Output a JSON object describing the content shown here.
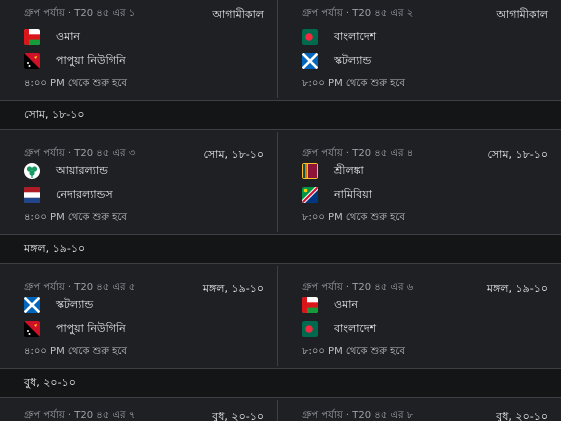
{
  "rows": [
    {
      "left": {
        "meta": "গ্রুপ পর্যায় · T20 ৪৫ এর ১",
        "time": "আগামীকাল",
        "team1": "ওমান",
        "team2": "পাপুয়া নিউগিনি",
        "start": "৪:০০ PM থেকে শুরু হবে"
      },
      "right": {
        "meta": "গ্রুপ পর্যায় · T20 ৪৫ এর ২",
        "time": "আগামীকাল",
        "team1": "বাংলাদেশ",
        "team2": "স্কটল্যান্ড",
        "start": "৮:০০ PM থেকে শুরু হবে"
      }
    },
    {
      "header": "সোম, ১৮-১০",
      "left": {
        "meta": "গ্রুপ পর্যায় · T20 ৪৫ এর ৩",
        "time": "সোম, ১৮-১০",
        "team1": "আয়ারল্যান্ড",
        "team2": "নেদারল্যান্ডস",
        "start": "৪:০০ PM থেকে শুরু হবে"
      },
      "right": {
        "meta": "গ্রুপ পর্যায় · T20 ৪৫ এর ৪",
        "time": "সোম, ১৮-১০",
        "team1": "শ্রীলঙ্কা",
        "team2": "নামিবিয়া",
        "start": "৮:০০ PM থেকে শুরু হবে"
      }
    },
    {
      "header": "মঙ্গল, ১৯-১০",
      "left": {
        "meta": "গ্রুপ পর্যায় · T20 ৪৫ এর ৫",
        "time": "মঙ্গল, ১৯-১০",
        "team1": "স্কটল্যান্ড",
        "team2": "পাপুয়া নিউগিনি",
        "start": "৪:০০ PM থেকে শুরু হবে"
      },
      "right": {
        "meta": "গ্রুপ পর্যায় · T20 ৪৫ এর ৬",
        "time": "মঙ্গল, ১৯-১০",
        "team1": "ওমান",
        "team2": "বাংলাদেশ",
        "start": "৮:০০ PM থেকে শুরু হবে"
      }
    },
    {
      "header": "বুধ, ২০-১০",
      "left": {
        "meta": "গ্রুপ পর্যায় · T20 ৪৫ এর ৭",
        "time": "বুধ, ২০-১০"
      },
      "right": {
        "meta": "গ্রুপ পর্যায় · T20 ৪৫ এর ৮",
        "time": "বুধ, ২০-১০"
      }
    }
  ],
  "flags": {
    "oman": "oman-flag-icon",
    "png": "papua-new-guinea-flag-icon",
    "bangladesh": "bangladesh-flag-icon",
    "scotland": "scotland-flag-icon",
    "ireland": "ireland-flag-icon",
    "netherlands": "netherlands-flag-icon",
    "srilanka": "sri-lanka-flag-icon",
    "namibia": "namibia-flag-icon"
  },
  "colors": {
    "background": "#1f2023",
    "header_background": "#141517",
    "divider": "#3c4043",
    "muted_text": "#9aa0a6"
  }
}
